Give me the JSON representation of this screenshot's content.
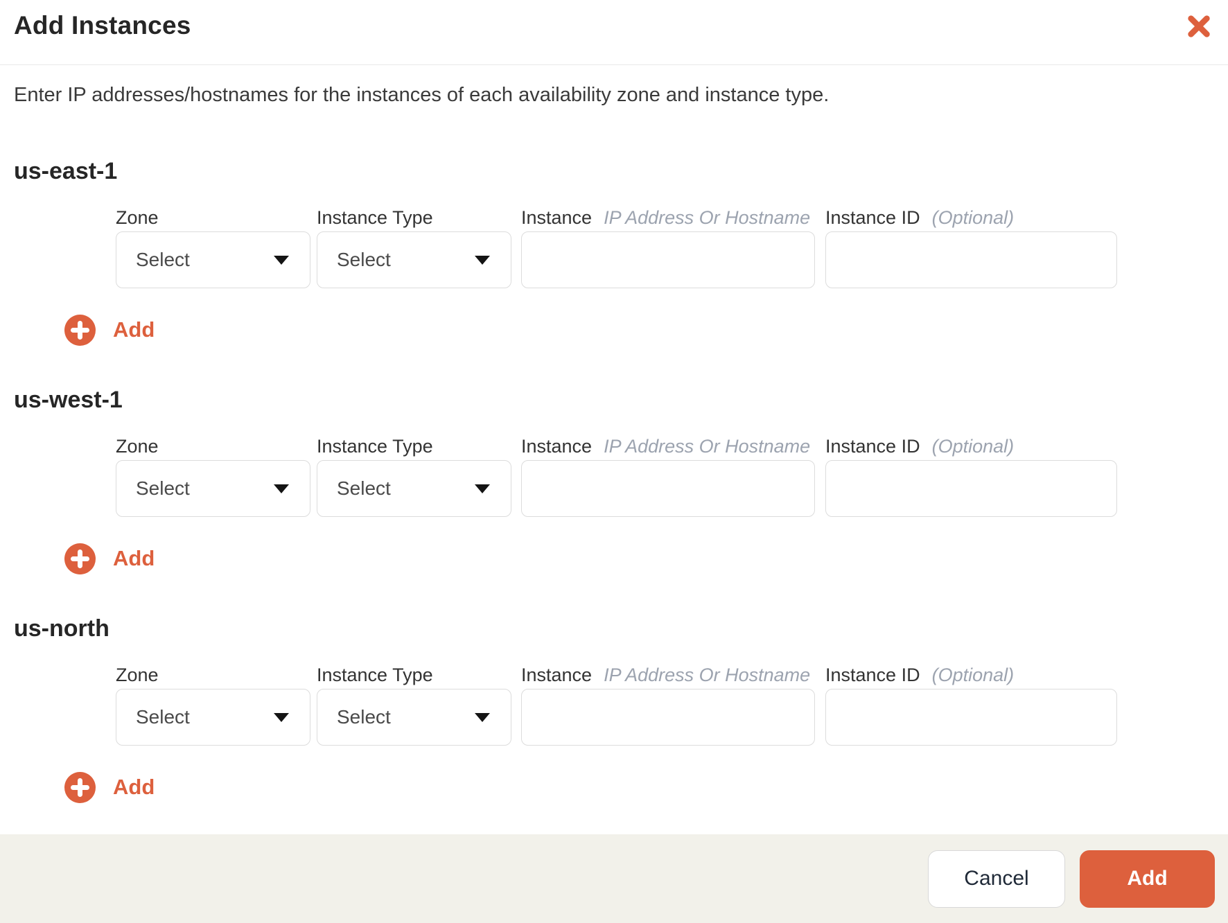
{
  "modal": {
    "title": "Add Instances",
    "description": "Enter IP addresses/hostnames for the instances of each availability zone and instance type."
  },
  "labels": {
    "zone": "Zone",
    "instance_type": "Instance Type",
    "instance": "Instance",
    "instance_hint": "IP Address Or Hostname",
    "instance_id": "Instance ID",
    "instance_id_hint": "(Optional)",
    "add_row": "Add"
  },
  "sections": [
    {
      "name": "us-east-1",
      "zone_value": "Select",
      "instance_type_value": "Select",
      "instance_value": "",
      "instance_id_value": ""
    },
    {
      "name": "us-west-1",
      "zone_value": "Select",
      "instance_type_value": "Select",
      "instance_value": "",
      "instance_id_value": ""
    },
    {
      "name": "us-north",
      "zone_value": "Select",
      "instance_type_value": "Select",
      "instance_value": "",
      "instance_id_value": ""
    }
  ],
  "footer": {
    "cancel_label": "Cancel",
    "add_label": "Add"
  },
  "icons": {
    "close": "close-icon",
    "add": "plus-circle-icon",
    "select_caret": "chevron-down-icon"
  },
  "colors": {
    "accent": "#DD603D",
    "footer_bg": "#F2F1EA",
    "border": "#D8D8D8",
    "field_border": "#DCDCDC",
    "hint_gray": "#9CA3AF"
  }
}
